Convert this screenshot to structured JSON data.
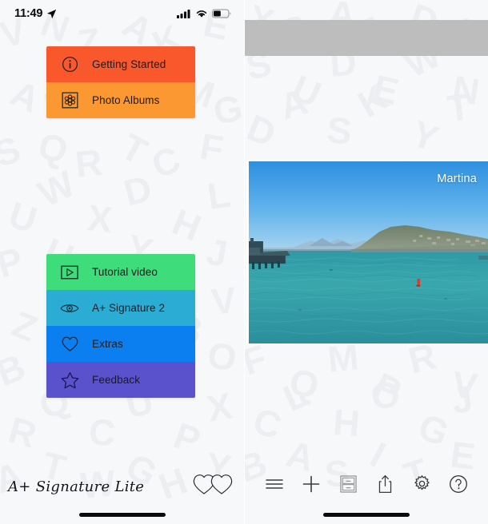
{
  "status_bar": {
    "time": "11:49",
    "location_icon": "location-arrow-icon",
    "cellular_icon": "cellular-signal-icon",
    "wifi_icon": "wifi-icon",
    "battery_icon": "battery-icon"
  },
  "left_pane": {
    "menu_top": {
      "items": [
        {
          "label": "Getting Started",
          "icon": "info-circle-icon",
          "bg": "#f9572c"
        },
        {
          "label": "Photo Albums",
          "icon": "photo-albums-flower-icon",
          "bg": "#fb9832"
        }
      ]
    },
    "menu_bottom": {
      "items": [
        {
          "label": "Tutorial video",
          "icon": "play-video-icon",
          "bg": "#3edc7a"
        },
        {
          "label": "A+ Signature 2",
          "icon": "eye-icon",
          "bg": "#2bacd4"
        },
        {
          "label": "Extras",
          "icon": "heart-icon",
          "bg": "#0b7ff0"
        },
        {
          "label": "Feedback",
          "icon": "star-icon",
          "bg": "#5a52cd"
        }
      ]
    },
    "brand": "A+ Signature Lite",
    "hearts_logo": "double-heart-logo-icon"
  },
  "right_pane": {
    "ad_banner_label": "",
    "photo": {
      "watermark": "Martina",
      "alt_description": "Seascape with pier and hillside town"
    },
    "toolbar": {
      "items": [
        {
          "name": "menu-button",
          "icon": "hamburger-menu-icon"
        },
        {
          "name": "add-button",
          "icon": "plus-icon"
        },
        {
          "name": "albums-button",
          "icon": "file-cabinet-icon"
        },
        {
          "name": "share-button",
          "icon": "share-icon"
        },
        {
          "name": "settings-button",
          "icon": "gear-icon"
        },
        {
          "name": "help-button",
          "icon": "question-circle-icon"
        }
      ]
    }
  },
  "colors": {
    "background": "#f7f8fa",
    "orange_primary": "#f9572c",
    "orange_secondary": "#fb9832",
    "green": "#3edc7a",
    "teal": "#2bacd4",
    "blue": "#0b7ff0",
    "purple": "#5a52cd",
    "ad_gray": "#bdbdbd",
    "text_dark": "#1b1b1f"
  }
}
